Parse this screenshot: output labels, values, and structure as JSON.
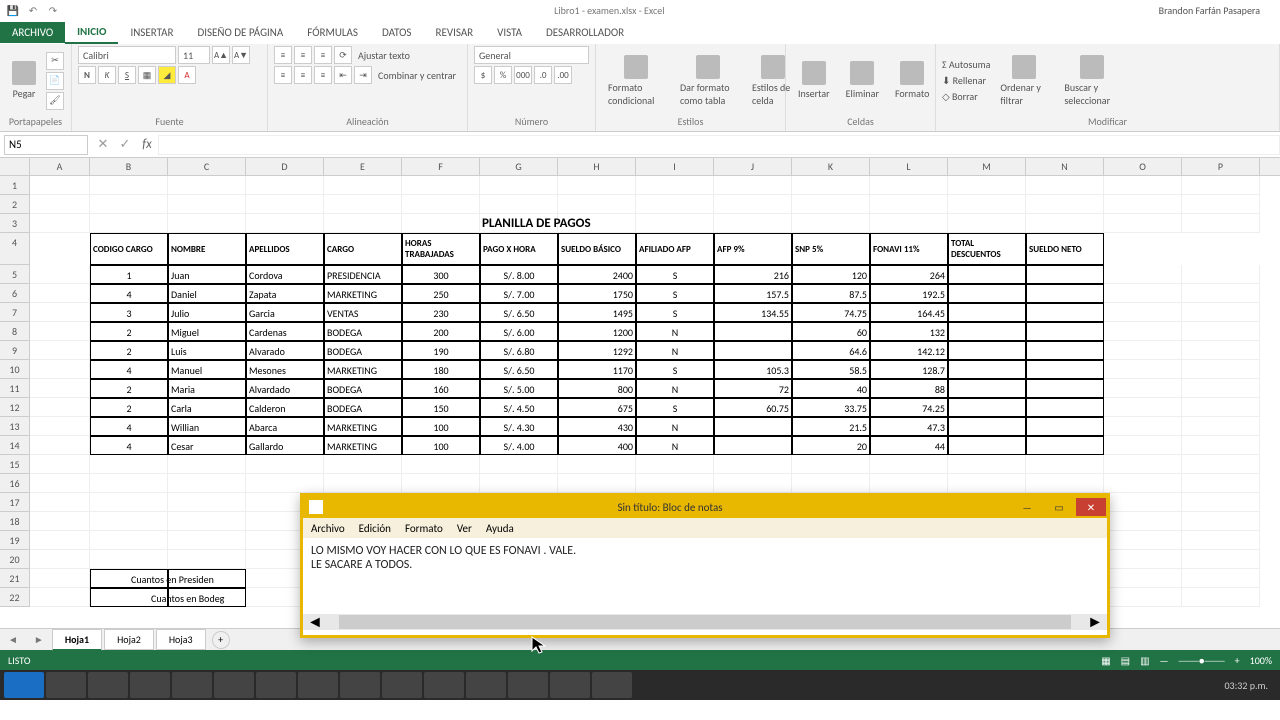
{
  "app": {
    "title": "Libro1 - examen.xlsx - Excel",
    "user": "Brandon Farfán Pasapera"
  },
  "tabs": {
    "file": "ARCHIVO",
    "inicio": "INICIO",
    "insertar": "INSERTAR",
    "diseno": "DISEÑO DE PÁGINA",
    "formulas": "FÓRMULAS",
    "datos": "DATOS",
    "revisar": "REVISAR",
    "vista": "VISTA",
    "desarrollador": "DESARROLLADOR"
  },
  "ribbon": {
    "portapapeles": {
      "label": "Portapapeles",
      "pegar": "Pegar"
    },
    "fuente": {
      "label": "Fuente",
      "font": "Calibri",
      "size": "11"
    },
    "alineacion": {
      "label": "Alineación",
      "ajustar": "Ajustar texto",
      "combinar": "Combinar y centrar"
    },
    "numero": {
      "label": "Número",
      "format": "General"
    },
    "estilos": {
      "label": "Estilos",
      "cond": "Formato condicional",
      "tabla": "Dar formato como tabla",
      "celda": "Estilos de celda"
    },
    "celdas": {
      "label": "Celdas",
      "insertar": "Insertar",
      "eliminar": "Eliminar",
      "formato": "Formato"
    },
    "modificar": {
      "label": "Modificar",
      "autosuma": "Autosuma",
      "rellenar": "Rellenar",
      "borrar": "Borrar",
      "ordenar": "Ordenar y filtrar",
      "buscar": "Buscar y seleccionar"
    }
  },
  "namebox": "N5",
  "columns": [
    "A",
    "B",
    "C",
    "D",
    "E",
    "F",
    "G",
    "H",
    "I",
    "J",
    "K",
    "L",
    "M",
    "N",
    "O",
    "P"
  ],
  "sheet": {
    "title": "PLANILLA DE PAGOS",
    "headers": [
      "CODIGO CARGO",
      "NOMBRE",
      "APELLIDOS",
      "CARGO",
      "HORAS TRABAJADAS",
      "PAGO X HORA",
      "SUELDO BÁSICO",
      "AFILIADO AFP",
      "AFP 9%",
      "SNP 5%",
      "FONAVI 11%",
      "TOTAL DESCUENTOS",
      "SUELDO NETO"
    ],
    "rows": [
      {
        "cod": "1",
        "nom": "Juan",
        "ape": "Cordova",
        "car": "PRESIDENCIA",
        "hor": "300",
        "pago": "S/. 8.00",
        "sb": "2400",
        "af": "S",
        "afp": "216",
        "snp": "120",
        "fon": "264"
      },
      {
        "cod": "4",
        "nom": "Daniel",
        "ape": "Zapata",
        "car": "MARKETING",
        "hor": "250",
        "pago": "S/. 7.00",
        "sb": "1750",
        "af": "S",
        "afp": "157.5",
        "snp": "87.5",
        "fon": "192.5"
      },
      {
        "cod": "3",
        "nom": "Julio",
        "ape": "Garcia",
        "car": "VENTAS",
        "hor": "230",
        "pago": "S/. 6.50",
        "sb": "1495",
        "af": "S",
        "afp": "134.55",
        "snp": "74.75",
        "fon": "164.45"
      },
      {
        "cod": "2",
        "nom": "Miguel",
        "ape": "Cardenas",
        "car": "BODEGA",
        "hor": "200",
        "pago": "S/. 6.00",
        "sb": "1200",
        "af": "N",
        "afp": "",
        "snp": "60",
        "fon": "132"
      },
      {
        "cod": "2",
        "nom": "Luis",
        "ape": "Alvarado",
        "car": "BODEGA",
        "hor": "190",
        "pago": "S/. 6.80",
        "sb": "1292",
        "af": "N",
        "afp": "",
        "snp": "64.6",
        "fon": "142.12"
      },
      {
        "cod": "4",
        "nom": "Manuel",
        "ape": "Mesones",
        "car": "MARKETING",
        "hor": "180",
        "pago": "S/. 6.50",
        "sb": "1170",
        "af": "S",
        "afp": "105.3",
        "snp": "58.5",
        "fon": "128.7"
      },
      {
        "cod": "2",
        "nom": "Maria",
        "ape": "Alvardado",
        "car": "BODEGA",
        "hor": "160",
        "pago": "S/. 5.00",
        "sb": "800",
        "af": "N",
        "afp": "72",
        "snp": "40",
        "fon": "88"
      },
      {
        "cod": "2",
        "nom": "Carla",
        "ape": "Calderon",
        "car": "BODEGA",
        "hor": "150",
        "pago": "S/. 4.50",
        "sb": "675",
        "af": "S",
        "afp": "60.75",
        "snp": "33.75",
        "fon": "74.25"
      },
      {
        "cod": "4",
        "nom": "Willian",
        "ape": "Abarca",
        "car": "MARKETING",
        "hor": "100",
        "pago": "S/. 4.30",
        "sb": "430",
        "af": "N",
        "afp": "",
        "snp": "21.5",
        "fon": "47.3"
      },
      {
        "cod": "4",
        "nom": "Cesar",
        "ape": "Gallardo",
        "car": "MARKETING",
        "hor": "100",
        "pago": "S/. 4.00",
        "sb": "400",
        "af": "N",
        "afp": "",
        "snp": "20",
        "fon": "44"
      }
    ],
    "summary": {
      "presidencia": "Cuantos en Presiden",
      "bodega": "Cuantos en Bodeg"
    }
  },
  "notepad": {
    "title": "Sin título: Bloc de notas",
    "menu": {
      "archivo": "Archivo",
      "edicion": "Edición",
      "formato": "Formato",
      "ver": "Ver",
      "ayuda": "Ayuda"
    },
    "line1": "LO MISMO VOY HACER CON LO QUE ES FONAVI . VALE.",
    "line2": "LE SACARE A TODOS."
  },
  "sheettabs": {
    "h1": "Hoja1",
    "h2": "Hoja2",
    "h3": "Hoja3"
  },
  "status": {
    "ready": "LISTO",
    "zoom": "100%",
    "time": "03:32 p.m."
  }
}
